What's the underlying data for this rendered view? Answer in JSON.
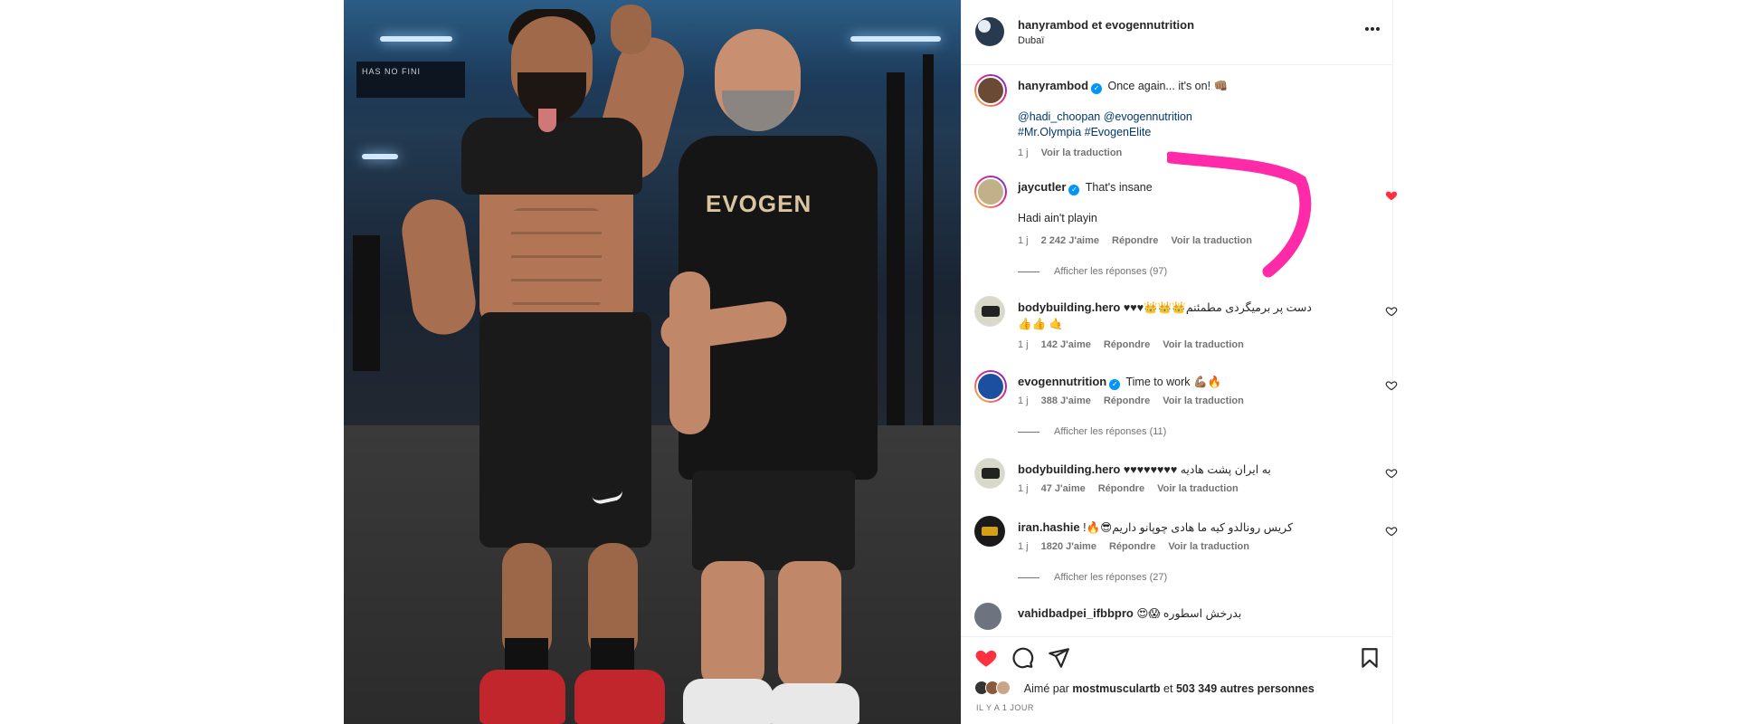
{
  "post": {
    "header": {
      "username": "hanyrambod et evogennutrition",
      "location": "Dubaï"
    },
    "caption": {
      "username": "hanyrambod",
      "text": "Once again... it's on! 👊🏽",
      "mentions": "@hadi_choopan @evogennutrition",
      "hashtags": "#Mr.Olympia #EvogenElite",
      "age": "1 j",
      "translate": "Voir la traduction"
    },
    "photo": {
      "sign_line1": "HAS NO FINI",
      "shirt_logo": "EVOGEN"
    }
  },
  "comments": [
    {
      "username": "jaycutler",
      "text": "That's insane",
      "text2": "Hadi ain't playin",
      "age": "1 j",
      "likes": "2 242 J'aime",
      "reply": "Répondre",
      "translate": "Voir la traduction",
      "replies": "Afficher les réponses (97)",
      "liked": true
    },
    {
      "username": "bodybuilding.hero",
      "text": "دست پر برمیگردی مطمئنم👑👑👑♥♥♥🤙 👍👍",
      "age": "1 j",
      "likes": "142 J'aime",
      "reply": "Répondre",
      "translate": "Voir la traduction"
    },
    {
      "username": "evogennutrition",
      "text": "Time to work 💪🏽🔥",
      "age": "1 j",
      "likes": "388 J'aime",
      "reply": "Répondre",
      "translate": "Voir la traduction",
      "replies": "Afficher les réponses (11)"
    },
    {
      "username": "bodybuilding.hero",
      "text": "به ایران پشت هادیه ♥♥♥♥♥♥♥♥",
      "age": "1 j",
      "likes": "47 J'aime",
      "reply": "Répondre",
      "translate": "Voir la traduction"
    },
    {
      "username": "iran.hashie",
      "text": "کریس رونالدو کیه ما هادی چوپانو داریم😎🔥!",
      "age": "1 j",
      "likes": "1820 J'aime",
      "reply": "Répondre",
      "translate": "Voir la traduction",
      "replies": "Afficher les réponses (27)"
    },
    {
      "username": "vahidbadpei_ifbbpro",
      "text": "بدرخش اسطوره 😱😍"
    }
  ],
  "footer": {
    "liked_by_prefix": "Aimé par",
    "liked_by_user": "mostmusculartb",
    "liked_by_sep": "et",
    "liked_by_count": "503 349 autres personnes",
    "timestamp": "IL Y A 1 JOUR"
  },
  "colors": {
    "like_red": "#ff3040",
    "link_blue": "#00376b",
    "annotation_pink": "#ff2aa8",
    "verified_blue": "#0095f6"
  },
  "icons": [
    "heart-icon",
    "comment-icon",
    "share-icon",
    "bookmark-icon",
    "more-icon",
    "verified-icon"
  ]
}
